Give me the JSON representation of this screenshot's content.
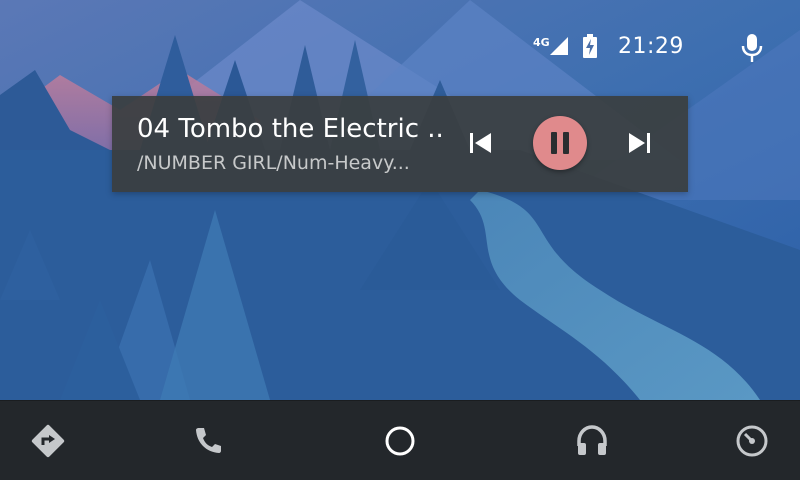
{
  "status_bar": {
    "network_label": "4G",
    "clock": "21:29",
    "icons": [
      "signal-icon",
      "battery-charging-icon",
      "microphone-icon"
    ]
  },
  "media": {
    "title": "04 Tombo the Electric ...",
    "subtitle": "/NUMBER GIRL/Num-Heavy...",
    "playing": true,
    "accent_color": "#e08a8c",
    "controls": [
      "skip-previous-icon",
      "pause-icon",
      "skip-next-icon"
    ]
  },
  "nav": {
    "items": [
      "navigation-icon",
      "phone-icon",
      "home-icon",
      "headphones-icon",
      "dashboard-gauge-icon"
    ]
  },
  "colors": {
    "nav_background": "#23272b",
    "card_background": "#3a3e40"
  }
}
